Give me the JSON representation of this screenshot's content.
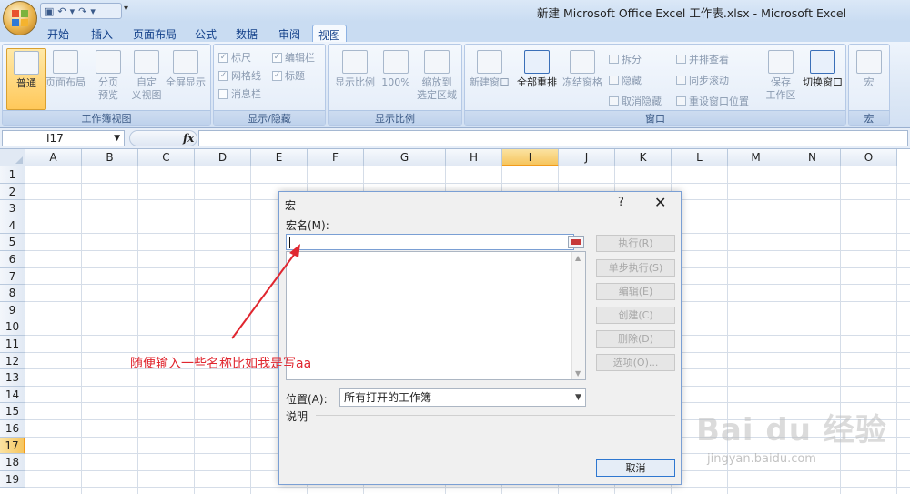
{
  "window": {
    "title": "新建 Microsoft Office Excel 工作表.xlsx - Microsoft Excel"
  },
  "qat": {
    "save_icon": "save-icon",
    "undo_icon": "undo-icon",
    "redo_icon": "redo-icon",
    "more": "▾"
  },
  "tabs": [
    {
      "label": "开始"
    },
    {
      "label": "插入"
    },
    {
      "label": "页面布局"
    },
    {
      "label": "公式"
    },
    {
      "label": "数据"
    },
    {
      "label": "审阅"
    },
    {
      "label": "视图"
    }
  ],
  "ribbon": {
    "groups": {
      "workbook_views": {
        "label": "工作簿视图",
        "normal": "普通",
        "page_layout": "页面布局",
        "page_break_1": "分页",
        "page_break_2": "预览",
        "custom_1": "自定",
        "custom_2": "义视图",
        "full_screen": "全屏显示"
      },
      "show_hide": {
        "label": "显示/隐藏",
        "ruler": "标尺",
        "formula_bar": "编辑栏",
        "gridlines": "网格线",
        "headings": "标题",
        "message_bar": "消息栏"
      },
      "zoom": {
        "label": "显示比例",
        "zoom": "显示比例",
        "zoom100": "100%",
        "zoom_sel_1": "缩放到",
        "zoom_sel_2": "选定区域"
      },
      "window": {
        "label": "窗口",
        "new_window": "新建窗口",
        "arrange_all": "全部重排",
        "freeze": "冻结窗格",
        "split": "拆分",
        "hide": "隐藏",
        "unhide": "取消隐藏",
        "side_by_side": "并排查看",
        "sync_scroll": "同步滚动",
        "reset_pos": "重设窗口位置",
        "save_ws_1": "保存",
        "save_ws_2": "工作区",
        "switch": "切换窗口"
      },
      "macros": {
        "label": "宏",
        "macros": "宏"
      }
    }
  },
  "formula": {
    "name_box": "I17",
    "fx": "fx"
  },
  "grid": {
    "columns": [
      "A",
      "B",
      "C",
      "D",
      "E",
      "F",
      "G",
      "H",
      "I",
      "J",
      "K",
      "L",
      "M",
      "N",
      "O"
    ],
    "rows": [
      "1",
      "2",
      "3",
      "4",
      "5",
      "6",
      "7",
      "8",
      "9",
      "10",
      "11",
      "12",
      "13",
      "14",
      "15",
      "16",
      "17",
      "18",
      "19"
    ],
    "active_column": "I",
    "active_row": "17"
  },
  "dialog": {
    "title": "宏",
    "help": "?",
    "close": "✕",
    "macro_name_label": "宏名(M):",
    "macro_name_value": "",
    "buttons": [
      "执行(R)",
      "单步执行(S)",
      "编辑(E)",
      "创建(C)",
      "删除(D)",
      "选项(O)..."
    ],
    "location_label": "位置(A):",
    "location_value": "所有打开的工作簿",
    "description_label": "说明",
    "cancel": "取消"
  },
  "annotation": {
    "text": "随便输入一些名称比如我是写aa",
    "color": "#e0262f"
  },
  "watermark": {
    "text": "Bai du 经验",
    "url": "jingyan.baidu.com"
  }
}
